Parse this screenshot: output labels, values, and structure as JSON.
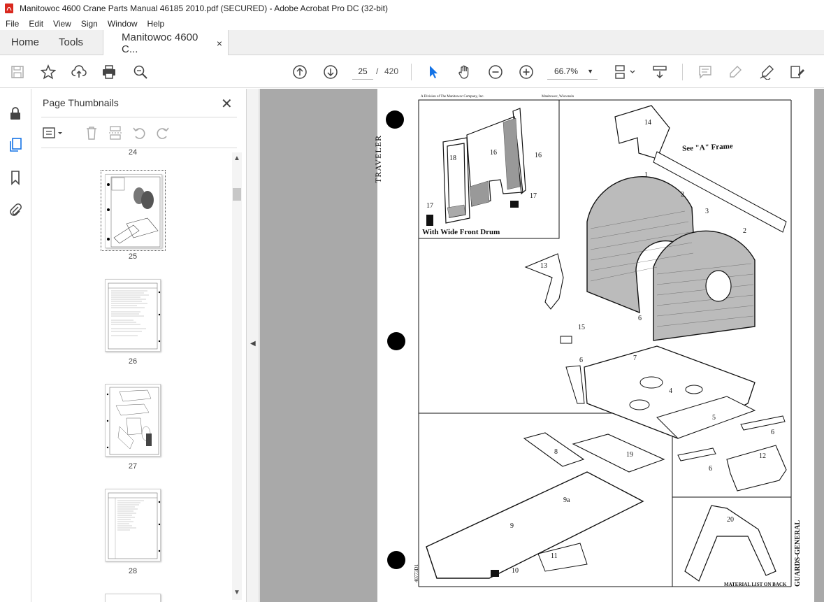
{
  "window": {
    "title": "Manitowoc 4600 Crane Parts Manual 46185 2010.pdf (SECURED) - Adobe Acrobat Pro DC (32-bit)"
  },
  "menu": [
    "File",
    "Edit",
    "View",
    "Sign",
    "Window",
    "Help"
  ],
  "tabs": {
    "home": "Home",
    "tools": "Tools",
    "document": "Manitowoc 4600 C...",
    "close": "×"
  },
  "toolbar": {
    "page_current": "25",
    "page_sep": "/",
    "page_total": "420",
    "zoom": "66.7%"
  },
  "panel": {
    "title": "Page Thumbnails",
    "close": "✕",
    "partial_label": "24",
    "thumbnails": [
      {
        "label": "25"
      },
      {
        "label": "26"
      },
      {
        "label": "27"
      },
      {
        "label": "28"
      }
    ]
  },
  "drawing": {
    "header_left": "A Division of The Manitowoc Company, Inc.",
    "header_right": "Manitowoc, Wisconsin",
    "inset_caption": "With Wide Front Drum",
    "frame_note": "See \"A\" Frame",
    "vertical_left": "TRAVELER",
    "side_label": "GUARDS-GENERAL",
    "footer": "MATERIAL LIST ON BACK",
    "doc_code": "40773D1",
    "callouts": [
      "18",
      "16",
      "16",
      "17",
      "17",
      "14",
      "1",
      "2",
      "3",
      "2",
      "13",
      "15",
      "6",
      "7",
      "6",
      "4",
      "5",
      "6",
      "8",
      "19",
      "12",
      "6",
      "9a",
      "9",
      "20",
      "11",
      "10"
    ]
  },
  "colors": {
    "accent": "#1473e6",
    "pdf_red": "#d9281e",
    "gray_bg": "#a9a9a9"
  }
}
